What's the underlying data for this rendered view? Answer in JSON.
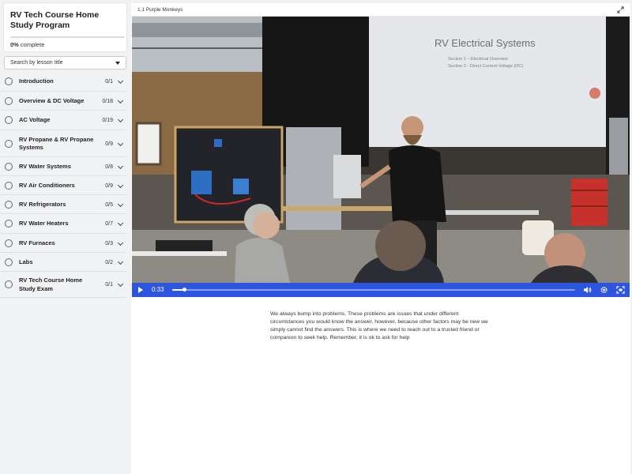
{
  "course": {
    "title": "RV Tech Course Home Study Program",
    "progress_percent": 0,
    "progress_value": "0%",
    "progress_suffix": " complete"
  },
  "search": {
    "placeholder": "Search by lesson title"
  },
  "lessons": [
    {
      "label": "Introduction",
      "count": "0/1"
    },
    {
      "label": "Overview & DC Voltage",
      "count": "0/18"
    },
    {
      "label": "AC Voltage",
      "count": "0/19"
    },
    {
      "label": "RV Propane & RV Propane Systems",
      "count": "0/9"
    },
    {
      "label": "RV Water Systems",
      "count": "0/8"
    },
    {
      "label": "RV Air Conditioners",
      "count": "0/9"
    },
    {
      "label": "RV Refrigerators",
      "count": "0/5"
    },
    {
      "label": "RV Water Heaters",
      "count": "0/7"
    },
    {
      "label": "RV Furnaces",
      "count": "0/3"
    },
    {
      "label": "Labs",
      "count": "0/2"
    },
    {
      "label": "RV Tech Course Home Study Exam",
      "count": "0/1"
    }
  ],
  "main": {
    "lesson_title": "1.1 Purple Monkeys",
    "slide": {
      "title": "RV Electrical Systems",
      "line1": "Section 1 – Electrical Overview",
      "line2": "Section 2 - Direct Current Voltage (DC)"
    },
    "video": {
      "time": "0:33",
      "played_fraction": 0.03
    },
    "description": "We always bump into problems. These problems are issues that under different circumstances you would know the answer, however, because other factors may be new we simply cannot find the answers. This is where we need to reach out to a trusted friend or companion to seek help. Remember, it is ok to ask for help"
  },
  "icons": {
    "expand": "expand-icon",
    "play": "play-icon",
    "volume": "volume-icon",
    "settings": "gear-icon",
    "fullscreen": "fullscreen-icon",
    "lesson_status": "circle-outline-icon",
    "lesson_expand": "chevron-down-icon",
    "select_caret": "caret-down-icon"
  },
  "colors": {
    "accent": "#2d55e0",
    "sidebar_bg": "#f1f2f4",
    "progress_fill": "#3a5fe0"
  }
}
